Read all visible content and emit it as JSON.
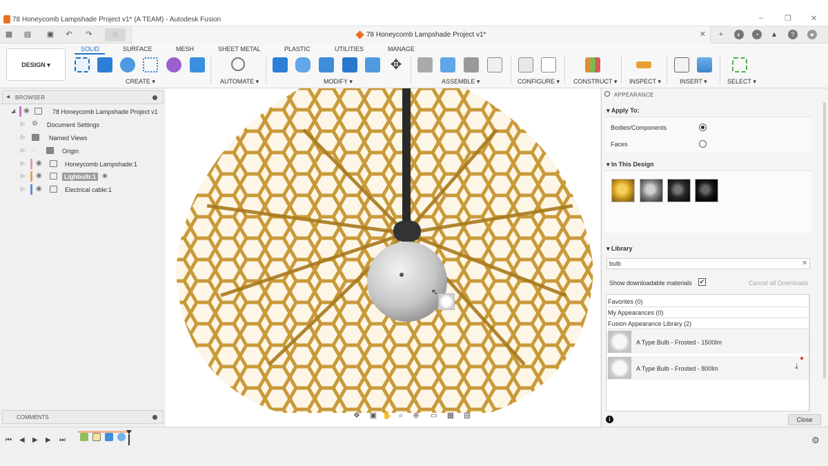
{
  "window": {
    "title": "78 Honeycomb Lampshade Project v1* (A TEAM) - Autodesk Fusion",
    "controls": [
      "–",
      "❐",
      "✕"
    ]
  },
  "quick_access": {
    "doc_tab_title": "78 Honeycomb Lampshade Project v1*",
    "tab_close": "✕"
  },
  "toolbar": {
    "workspace": "DESIGN ▾",
    "tabs": [
      "SOLID",
      "SURFACE",
      "MESH",
      "SHEET METAL",
      "PLASTIC",
      "UTILITIES",
      "MANAGE"
    ],
    "groups": [
      "CREATE ▾",
      "AUTOMATE ▾",
      "MODIFY ▾",
      "ASSEMBLE ▾",
      "CONFIGURE ▾",
      "CONSTRUCT ▾",
      "INSPECT ▾",
      "INSERT ▾",
      "SELECT ▾"
    ]
  },
  "browser": {
    "header": "BROWSER",
    "items": [
      {
        "label": "78 Honeycomb Lampshade Project v1",
        "color": "#c875c4"
      },
      {
        "label": "Document Settings",
        "color": ""
      },
      {
        "label": "Named Views",
        "color": ""
      },
      {
        "label": "Origin",
        "color": ""
      },
      {
        "label": "Honeycomb Lampshade:1",
        "color": "#e0a0a0"
      },
      {
        "label": "Lighbulb:1",
        "color": "#e8a060"
      },
      {
        "label": "Electrical cable:1",
        "color": "#5b8fd8"
      }
    ]
  },
  "comments": {
    "header": "COMMENTS"
  },
  "appearance": {
    "title": "APPEARANCE",
    "apply_to": {
      "header": "Apply To:",
      "options": [
        "Bodies/Components",
        "Faces"
      ],
      "selected": "Bodies/Components"
    },
    "in_this_design": {
      "header": "In This Design",
      "swatches": [
        "#d9a520",
        "#8a8a8a",
        "#2a2a2a",
        "#1a1a1a"
      ]
    },
    "library": {
      "header": "Library",
      "search_value": "bulb",
      "search_clear": "✕",
      "show_downloadable_label": "Show downloadable materials",
      "show_downloadable_checked": true,
      "cancel_downloads": "Cancel all Downloads",
      "favorites": "Favorites (0)",
      "my_appearances": "My Appearances (0)",
      "fusion_library": "Fusion Appearance Library (2)",
      "materials": [
        "A Type Bulb - Frosted - 1500lm",
        "A Type Bulb - Frosted - 800lm"
      ]
    },
    "info_icon": "i",
    "close_label": "Close"
  },
  "colors": {
    "accent": "#1a73c9",
    "honeycomb": "#c99a3a",
    "honeycomb_dark": "#8a6420",
    "bulb": "#c9c9c9"
  }
}
